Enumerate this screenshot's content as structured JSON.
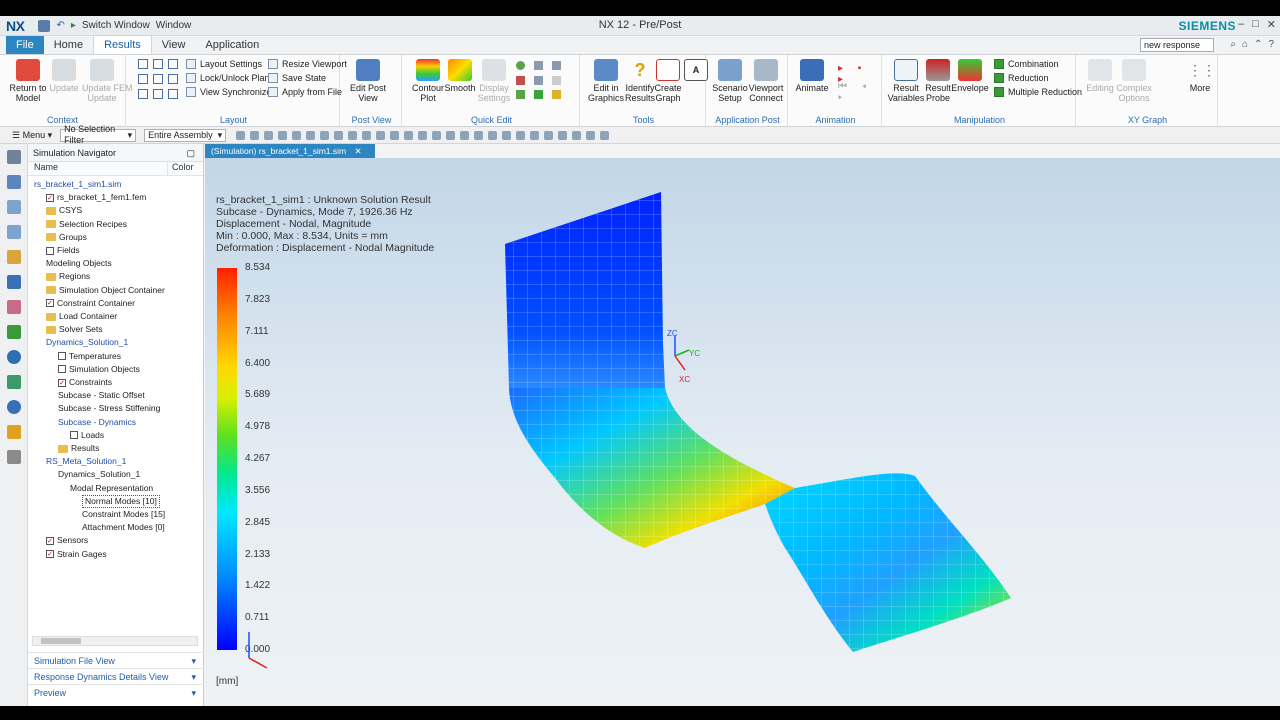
{
  "titlebar": {
    "app_logo": "NX",
    "switch_window": "Switch Window",
    "window_menu": "Window",
    "title": "NX 12 - Pre/Post",
    "brand": "SIEMENS"
  },
  "tabs": {
    "file": "File",
    "items": [
      "Home",
      "Results",
      "View",
      "Application"
    ],
    "active": "Results",
    "search_value": "new response"
  },
  "ribbon": {
    "context": {
      "label": "Context",
      "return_to_model": "Return to\nModel",
      "update": "Update",
      "update_fem": "Update FEM\nUpdate"
    },
    "layout": {
      "label": "Layout",
      "layout_settings": "Layout Settings",
      "resize_viewport": "Resize Viewport",
      "lock_unlock": "Lock/Unlock Plane",
      "save_state": "Save State",
      "view_sync": "View Synchronize",
      "apply_from_file": "Apply from File"
    },
    "post_view": {
      "label": "Post View",
      "edit_post_view": "Edit Post\nView"
    },
    "quick_edit": {
      "label": "Quick Edit",
      "contour_plot": "Contour\nPlot",
      "smooth": "Smooth",
      "display_settings": "Display\nSettings"
    },
    "tools": {
      "label": "Tools",
      "edit_in_graphics": "Edit in\nGraphics",
      "identify_results": "Identify\nResults",
      "create_graph": "Create\nGraph"
    },
    "app_post": {
      "label": "Application Post",
      "scenario_setup": "Scenario\nSetup",
      "viewport_connect": "Viewport\nConnect"
    },
    "animation": {
      "label": "Animation",
      "animate": "Animate"
    },
    "manipulation": {
      "label": "Manipulation",
      "result_variables": "Result\nVariables",
      "result_probe": "Result\nProbe",
      "envelope": "Envelope",
      "combination": "Combination",
      "reduction": "Reduction",
      "multiple_reduction": "Multiple Reduction"
    },
    "xy_graph": {
      "label": "XY Graph",
      "editing": "Editing",
      "complex_options": "Complex\nOptions",
      "more": "More"
    }
  },
  "selbar": {
    "menu": "Menu",
    "filter": "No Selection Filter",
    "assembly": "Entire Assembly"
  },
  "navigator": {
    "title": "Simulation Navigator",
    "col_name": "Name",
    "col_color": "Color",
    "tree": [
      {
        "label": "rs_bracket_1_sim1.sim",
        "indent": 0,
        "blue": true,
        "icon": "sim"
      },
      {
        "label": "rs_bracket_1_fem1.fem",
        "indent": 1,
        "check": true
      },
      {
        "label": "CSYS",
        "indent": 1,
        "icon": "folder"
      },
      {
        "label": "Selection Recipes",
        "indent": 1,
        "icon": "folder"
      },
      {
        "label": "Groups",
        "indent": 1,
        "icon": "folder"
      },
      {
        "label": "Fields",
        "indent": 1,
        "box": true
      },
      {
        "label": "Modeling Objects",
        "indent": 1
      },
      {
        "label": "Regions",
        "indent": 1,
        "icon": "folder"
      },
      {
        "label": "Simulation Object Container",
        "indent": 1,
        "icon": "folder"
      },
      {
        "label": "Constraint Container",
        "indent": 1,
        "check": true
      },
      {
        "label": "Load Container",
        "indent": 1,
        "icon": "folder"
      },
      {
        "label": "Solver Sets",
        "indent": 1,
        "icon": "folder"
      },
      {
        "label": "Dynamics_Solution_1",
        "indent": 1,
        "blue": true
      },
      {
        "label": "Temperatures",
        "indent": 2,
        "box": true
      },
      {
        "label": "Simulation Objects",
        "indent": 2,
        "box": true
      },
      {
        "label": "Constraints",
        "indent": 2,
        "check": true
      },
      {
        "label": "Subcase - Static Offset",
        "indent": 2
      },
      {
        "label": "Subcase - Stress Stiffening",
        "indent": 2
      },
      {
        "label": "Subcase - Dynamics",
        "indent": 2,
        "blue": true
      },
      {
        "label": "Loads",
        "indent": 3,
        "box": true
      },
      {
        "label": "Results",
        "indent": 2,
        "icon": "folder"
      },
      {
        "label": "RS_Meta_Solution_1",
        "indent": 1,
        "blue": true
      },
      {
        "label": "Dynamics_Solution_1",
        "indent": 2
      },
      {
        "label": "Modal Representation",
        "indent": 3
      },
      {
        "label": "Normal Modes [10]",
        "indent": 4,
        "selected": true
      },
      {
        "label": "Constraint Modes [15]",
        "indent": 4
      },
      {
        "label": "Attachment Modes [0]",
        "indent": 4
      },
      {
        "label": "Sensors",
        "indent": 1,
        "check": true
      },
      {
        "label": "Strain Gages",
        "indent": 1,
        "check": true
      }
    ],
    "panels": [
      "Simulation File View",
      "Response Dynamics Details View",
      "Preview"
    ]
  },
  "graphics": {
    "tab_label": "(Simulation) rs_bracket_1_sim1.sim",
    "info_lines": [
      "rs_bracket_1_sim1 : Unknown Solution Result",
      "Subcase - Dynamics, Mode 7, 1926.36 Hz",
      "Displacement - Nodal, Magnitude",
      "Min : 0.000, Max : 8.534, Units = mm",
      "Deformation : Displacement - Nodal Magnitude"
    ],
    "legend_ticks": [
      "8.534",
      "7.823",
      "7.111",
      "6.400",
      "5.689",
      "4.978",
      "4.267",
      "3.556",
      "2.845",
      "2.133",
      "1.422",
      "0.711",
      "0.000"
    ],
    "unit": "[mm]",
    "triad_labels": [
      "ZC",
      "YC",
      "XC"
    ]
  }
}
